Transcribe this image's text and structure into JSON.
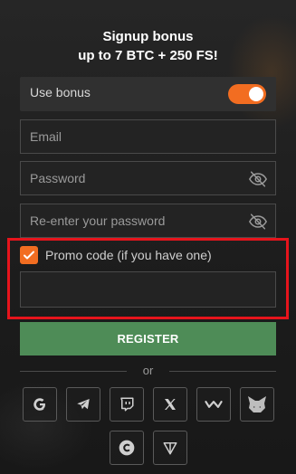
{
  "header": {
    "title_line1": "Signup bonus",
    "title_line2": "up to 7 BTC + 250 FS!"
  },
  "bonus": {
    "label": "Use bonus",
    "enabled": true
  },
  "form": {
    "email_placeholder": "Email",
    "password_placeholder": "Password",
    "repassword_placeholder": "Re-enter your password",
    "promo_label": "Promo code (if you have one)",
    "promo_checked": true,
    "promo_value": ""
  },
  "register_label": "REGISTER",
  "divider_text": "or",
  "social": [
    {
      "icon": "google-icon"
    },
    {
      "icon": "telegram-icon"
    },
    {
      "icon": "twitch-icon"
    },
    {
      "icon": "x-icon"
    },
    {
      "icon": "walletconnect-icon"
    },
    {
      "icon": "metamask-icon"
    },
    {
      "icon": "coinbase-icon"
    },
    {
      "icon": "ton-icon"
    }
  ],
  "colors": {
    "accent": "#f26d21",
    "register": "#4e8c57",
    "highlight": "#e6141c"
  }
}
